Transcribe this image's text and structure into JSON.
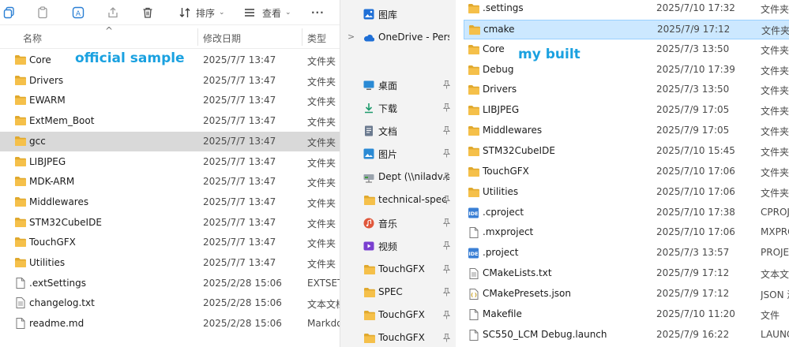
{
  "left_window": {
    "toolbar": {
      "sort_label": "排序",
      "view_label": "查看",
      "more_label": "···"
    },
    "columns": {
      "name": "名称",
      "date": "修改日期",
      "type": "类型"
    },
    "annotation": "official sample",
    "rows": [
      {
        "name": "Core",
        "date": "2025/7/7 13:47",
        "type": "文件夹",
        "kind": "folder"
      },
      {
        "name": "Drivers",
        "date": "2025/7/7 13:47",
        "type": "文件夹",
        "kind": "folder"
      },
      {
        "name": "EWARM",
        "date": "2025/7/7 13:47",
        "type": "文件夹",
        "kind": "folder"
      },
      {
        "name": "ExtMem_Boot",
        "date": "2025/7/7 13:47",
        "type": "文件夹",
        "kind": "folder"
      },
      {
        "name": "gcc",
        "date": "2025/7/7 13:47",
        "type": "文件夹",
        "kind": "folder",
        "selected": true
      },
      {
        "name": "LIBJPEG",
        "date": "2025/7/7 13:47",
        "type": "文件夹",
        "kind": "folder"
      },
      {
        "name": "MDK-ARM",
        "date": "2025/7/7 13:47",
        "type": "文件夹",
        "kind": "folder"
      },
      {
        "name": "Middlewares",
        "date": "2025/7/7 13:47",
        "type": "文件夹",
        "kind": "folder"
      },
      {
        "name": "STM32CubeIDE",
        "date": "2025/7/7 13:47",
        "type": "文件夹",
        "kind": "folder"
      },
      {
        "name": "TouchGFX",
        "date": "2025/7/7 13:47",
        "type": "文件夹",
        "kind": "folder"
      },
      {
        "name": "Utilities",
        "date": "2025/7/7 13:47",
        "type": "文件夹",
        "kind": "folder"
      },
      {
        "name": ".extSettings",
        "date": "2025/2/28 15:06",
        "type": "EXTSET",
        "kind": "file"
      },
      {
        "name": "changelog.txt",
        "date": "2025/2/28 15:06",
        "type": "文本文档",
        "kind": "text"
      },
      {
        "name": "readme.md",
        "date": "2025/2/28 15:06",
        "type": "Markdo",
        "kind": "file"
      }
    ]
  },
  "right_window": {
    "annotation": "my built",
    "nav": [
      {
        "label": "图库",
        "icon": "gallery-icon",
        "color": "#1f6fd6"
      },
      {
        "label": "OneDrive - Perso",
        "icon": "onedrive-icon",
        "color": "#1f6fd6",
        "expandable": true
      },
      {
        "label": "桌面",
        "icon": "desktop-icon",
        "color": "#2a8ad4",
        "pinned": true
      },
      {
        "label": "下载",
        "icon": "download-icon",
        "color": "#1d9a6c",
        "pinned": true
      },
      {
        "label": "文档",
        "icon": "documents-icon",
        "color": "#6b7a8f",
        "pinned": true
      },
      {
        "label": "图片",
        "icon": "pictures-icon",
        "color": "#2a8ad4",
        "pinned": true
      },
      {
        "label": "Dept (\\\\niladv.c",
        "icon": "network-drive-icon",
        "color": "#3c9a3c",
        "pinned": true
      },
      {
        "label": "technical-spec",
        "icon": "folder-icon",
        "color": "#f2c14e",
        "pinned": true
      },
      {
        "label": "音乐",
        "icon": "music-icon",
        "color": "#e0573b",
        "pinned": true
      },
      {
        "label": "视频",
        "icon": "video-icon",
        "color": "#7a3fd0",
        "pinned": true
      },
      {
        "label": "TouchGFX",
        "icon": "folder-icon",
        "color": "#f2c14e",
        "pinned": true
      },
      {
        "label": "SPEC",
        "icon": "folder-icon",
        "color": "#f2c14e",
        "pinned": true
      },
      {
        "label": "TouchGFX",
        "icon": "folder-icon",
        "color": "#f2c14e",
        "pinned": true
      },
      {
        "label": "TouchGFX",
        "icon": "folder-icon",
        "color": "#f2c14e",
        "pinned": true
      }
    ],
    "rows": [
      {
        "name": ".settings",
        "date": "2025/7/10 17:32",
        "type": "文件夹",
        "kind": "folder"
      },
      {
        "name": "cmake",
        "date": "2025/7/9 17:12",
        "type": "文件夹",
        "kind": "folder",
        "selected": true
      },
      {
        "name": "Core",
        "date": "2025/7/3 13:50",
        "type": "文件夹",
        "kind": "folder"
      },
      {
        "name": "Debug",
        "date": "2025/7/10 17:39",
        "type": "文件夹",
        "kind": "folder"
      },
      {
        "name": "Drivers",
        "date": "2025/7/3 13:50",
        "type": "文件夹",
        "kind": "folder"
      },
      {
        "name": "LIBJPEG",
        "date": "2025/7/9 17:05",
        "type": "文件夹",
        "kind": "folder"
      },
      {
        "name": "Middlewares",
        "date": "2025/7/9 17:05",
        "type": "文件夹",
        "kind": "folder"
      },
      {
        "name": "STM32CubeIDE",
        "date": "2025/7/10 15:45",
        "type": "文件夹",
        "kind": "folder"
      },
      {
        "name": "TouchGFX",
        "date": "2025/7/10 17:06",
        "type": "文件夹",
        "kind": "folder"
      },
      {
        "name": "Utilities",
        "date": "2025/7/10 17:06",
        "type": "文件夹",
        "kind": "folder"
      },
      {
        "name": ".cproject",
        "date": "2025/7/10 17:38",
        "type": "CPROJE",
        "kind": "ide"
      },
      {
        "name": ".mxproject",
        "date": "2025/7/10 17:06",
        "type": "MXPRO",
        "kind": "file"
      },
      {
        "name": ".project",
        "date": "2025/7/3 13:57",
        "type": "PROJEC",
        "kind": "ide"
      },
      {
        "name": "CMakeLists.txt",
        "date": "2025/7/9 17:12",
        "type": "文本文",
        "kind": "text"
      },
      {
        "name": "CMakePresets.json",
        "date": "2025/7/9 17:12",
        "type": "JSON 源",
        "kind": "json"
      },
      {
        "name": "Makefile",
        "date": "2025/7/10 11:20",
        "type": "文件",
        "kind": "file"
      },
      {
        "name": "SC550_LCM Debug.launch",
        "date": "2025/7/9 16:22",
        "type": "LAUNC",
        "kind": "file"
      }
    ]
  },
  "colors": {
    "folder": "#f5c04a",
    "folder_dark": "#e0a92e",
    "annotation": "#1aa1e0",
    "selected_left": "#d9d9d9",
    "selected_right": "#cce8ff",
    "ide_badge": "#3a7fd5"
  }
}
